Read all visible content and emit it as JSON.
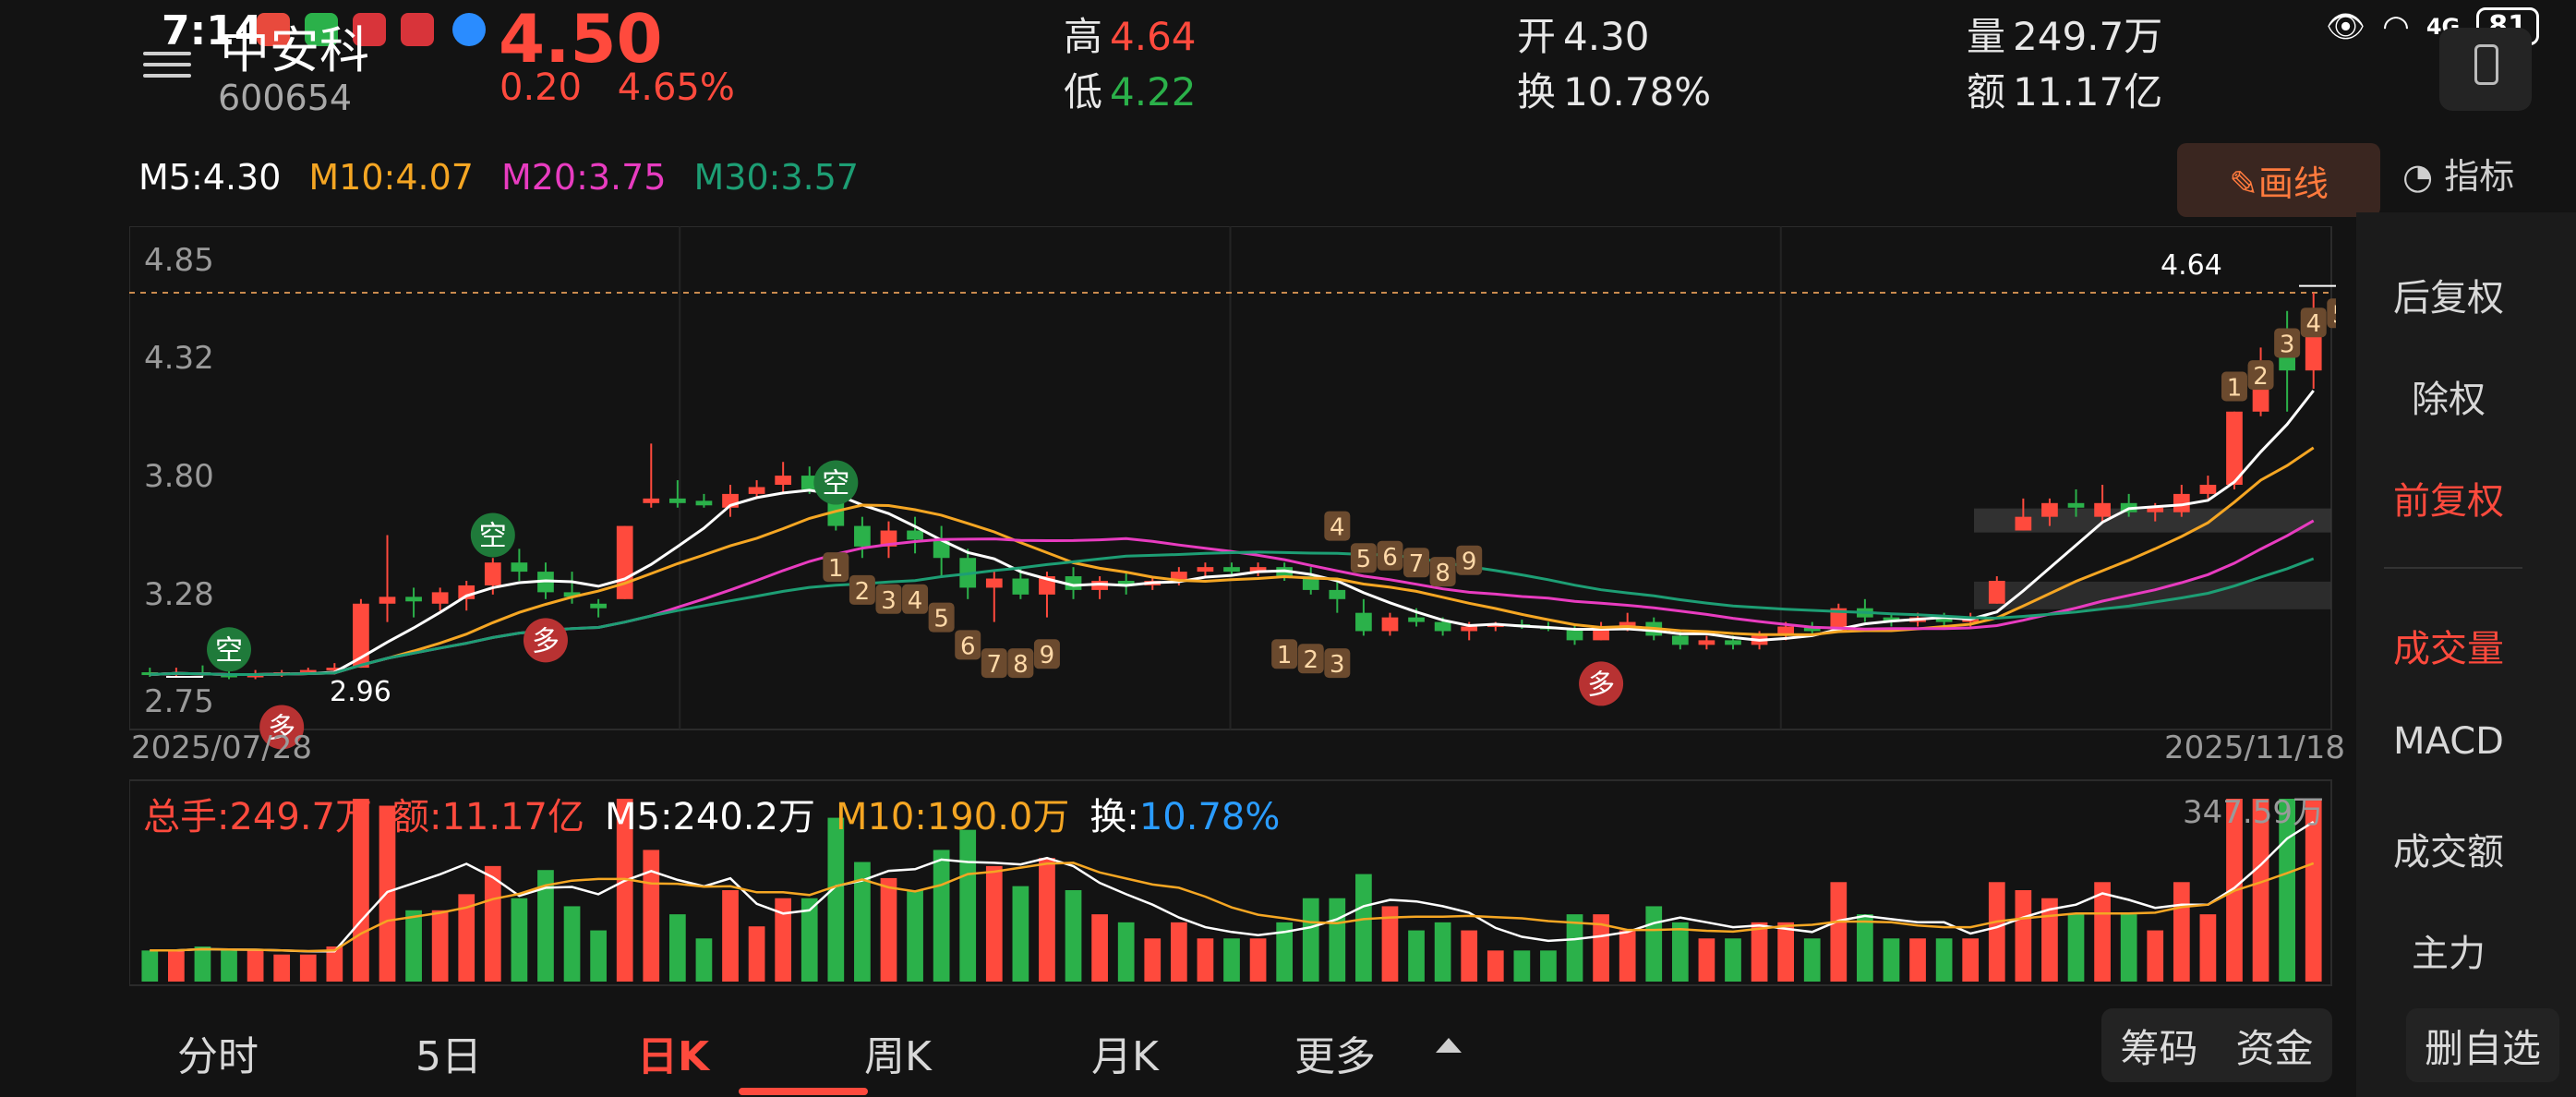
{
  "status": {
    "time": "7:14",
    "network": "4G",
    "battery": "81"
  },
  "stock": {
    "name": "中安科",
    "code": "600654",
    "price": "4.50",
    "change": "0.20",
    "change_pct": "4.65%",
    "high_label": "高",
    "high": "4.64",
    "low_label": "低",
    "low": "4.22",
    "open_label": "开",
    "open": "4.30",
    "turnover_label": "换",
    "turnover": "10.78%",
    "volume_label": "量",
    "volume": "249.7万",
    "amount_label": "额",
    "amount": "11.17亿"
  },
  "ma": {
    "m5": "M5:4.30",
    "m10": "M10:4.07",
    "m20": "M20:3.75",
    "m30": "M30:3.57"
  },
  "draw_button": "✎画线",
  "indicator_label": "指标",
  "side_options": [
    "后复权",
    "除权",
    "前复权"
  ],
  "side_active": "前复权",
  "side_indicators": [
    "成交量",
    "MACD",
    "成交额",
    "主力"
  ],
  "side_indicator_active": "成交量",
  "axis": {
    "y_ticks": [
      "4.85",
      "4.32",
      "3.80",
      "3.28",
      "2.75"
    ],
    "start_date": "2025/07/28",
    "end_date": "2025/11/18"
  },
  "annotations": {
    "max_label": "4.64",
    "min_label": "2.96",
    "bull": "多",
    "bear": "空"
  },
  "volume_panel": {
    "total": "总手:249.7万",
    "amount": "额:11.17亿",
    "m5": "M5:240.2万",
    "m10": "M10:190.0万",
    "turnover_label": "换:",
    "turnover": "10.78%",
    "max": "347.59万"
  },
  "tabs": [
    "分时",
    "5日",
    "日K",
    "周K",
    "月K",
    "更多"
  ],
  "active_tab": "日K",
  "bottom_buttons": {
    "chips": "筹码",
    "funds": "资金",
    "remove": "删自选"
  },
  "colors": {
    "up": "#ff4a3d",
    "down": "#2bb14a",
    "ma5": "#ffffff",
    "ma10": "#f5a623",
    "ma20": "#e83cc0",
    "ma30": "#1d9e74"
  },
  "chart_data": {
    "type": "candlestick",
    "y_range": [
      2.75,
      4.85
    ],
    "first_date": "2025/07/28",
    "last_date": "2025/11/18",
    "candles": [
      {
        "o": 2.98,
        "h": 3.0,
        "l": 2.96,
        "c": 2.97
      },
      {
        "o": 2.97,
        "h": 3.0,
        "l": 2.96,
        "c": 2.98
      },
      {
        "o": 2.98,
        "h": 3.01,
        "l": 2.96,
        "c": 2.97
      },
      {
        "o": 2.97,
        "h": 2.99,
        "l": 2.95,
        "c": 2.96
      },
      {
        "o": 2.96,
        "h": 2.99,
        "l": 2.95,
        "c": 2.97
      },
      {
        "o": 2.97,
        "h": 2.99,
        "l": 2.96,
        "c": 2.98
      },
      {
        "o": 2.98,
        "h": 3.0,
        "l": 2.97,
        "c": 2.99
      },
      {
        "o": 2.99,
        "h": 3.02,
        "l": 2.97,
        "c": 3.0
      },
      {
        "o": 3.0,
        "h": 3.3,
        "l": 3.0,
        "c": 3.28
      },
      {
        "o": 3.28,
        "h": 3.58,
        "l": 3.2,
        "c": 3.31
      },
      {
        "o": 3.31,
        "h": 3.35,
        "l": 3.22,
        "c": 3.29
      },
      {
        "o": 3.28,
        "h": 3.35,
        "l": 3.25,
        "c": 3.33
      },
      {
        "o": 3.3,
        "h": 3.38,
        "l": 3.25,
        "c": 3.36
      },
      {
        "o": 3.36,
        "h": 3.48,
        "l": 3.32,
        "c": 3.46
      },
      {
        "o": 3.46,
        "h": 3.52,
        "l": 3.38,
        "c": 3.42
      },
      {
        "o": 3.42,
        "h": 3.46,
        "l": 3.3,
        "c": 3.33
      },
      {
        "o": 3.33,
        "h": 3.42,
        "l": 3.28,
        "c": 3.31
      },
      {
        "o": 3.28,
        "h": 3.3,
        "l": 3.22,
        "c": 3.26
      },
      {
        "o": 3.3,
        "h": 3.62,
        "l": 3.3,
        "c": 3.62
      },
      {
        "o": 3.72,
        "h": 3.98,
        "l": 3.7,
        "c": 3.74
      },
      {
        "o": 3.74,
        "h": 3.82,
        "l": 3.7,
        "c": 3.72
      },
      {
        "o": 3.73,
        "h": 3.76,
        "l": 3.7,
        "c": 3.71
      },
      {
        "o": 3.7,
        "h": 3.8,
        "l": 3.66,
        "c": 3.76
      },
      {
        "o": 3.76,
        "h": 3.82,
        "l": 3.74,
        "c": 3.79
      },
      {
        "o": 3.8,
        "h": 3.9,
        "l": 3.76,
        "c": 3.84
      },
      {
        "o": 3.84,
        "h": 3.88,
        "l": 3.76,
        "c": 3.78
      },
      {
        "o": 3.78,
        "h": 3.82,
        "l": 3.6,
        "c": 3.62
      },
      {
        "o": 3.62,
        "h": 3.66,
        "l": 3.48,
        "c": 3.53
      },
      {
        "o": 3.53,
        "h": 3.64,
        "l": 3.48,
        "c": 3.6
      },
      {
        "o": 3.6,
        "h": 3.66,
        "l": 3.5,
        "c": 3.56
      },
      {
        "o": 3.56,
        "h": 3.62,
        "l": 3.4,
        "c": 3.48
      },
      {
        "o": 3.48,
        "h": 3.52,
        "l": 3.3,
        "c": 3.35
      },
      {
        "o": 3.35,
        "h": 3.42,
        "l": 3.2,
        "c": 3.39
      },
      {
        "o": 3.39,
        "h": 3.44,
        "l": 3.3,
        "c": 3.32
      },
      {
        "o": 3.32,
        "h": 3.42,
        "l": 3.22,
        "c": 3.4
      },
      {
        "o": 3.4,
        "h": 3.44,
        "l": 3.3,
        "c": 3.34
      },
      {
        "o": 3.34,
        "h": 3.4,
        "l": 3.3,
        "c": 3.38
      },
      {
        "o": 3.38,
        "h": 3.42,
        "l": 3.32,
        "c": 3.36
      },
      {
        "o": 3.36,
        "h": 3.4,
        "l": 3.34,
        "c": 3.38
      },
      {
        "o": 3.38,
        "h": 3.44,
        "l": 3.36,
        "c": 3.42
      },
      {
        "o": 3.42,
        "h": 3.46,
        "l": 3.4,
        "c": 3.44
      },
      {
        "o": 3.44,
        "h": 3.46,
        "l": 3.4,
        "c": 3.42
      },
      {
        "o": 3.42,
        "h": 3.46,
        "l": 3.4,
        "c": 3.44
      },
      {
        "o": 3.44,
        "h": 3.46,
        "l": 3.38,
        "c": 3.4
      },
      {
        "o": 3.4,
        "h": 3.44,
        "l": 3.32,
        "c": 3.34
      },
      {
        "o": 3.34,
        "h": 3.38,
        "l": 3.24,
        "c": 3.3
      },
      {
        "o": 3.24,
        "h": 3.3,
        "l": 3.14,
        "c": 3.16
      },
      {
        "o": 3.16,
        "h": 3.24,
        "l": 3.14,
        "c": 3.22
      },
      {
        "o": 3.22,
        "h": 3.26,
        "l": 3.18,
        "c": 3.2
      },
      {
        "o": 3.2,
        "h": 3.22,
        "l": 3.14,
        "c": 3.16
      },
      {
        "o": 3.16,
        "h": 3.2,
        "l": 3.12,
        "c": 3.18
      },
      {
        "o": 3.18,
        "h": 3.2,
        "l": 3.16,
        "c": 3.19
      },
      {
        "o": 3.19,
        "h": 3.21,
        "l": 3.17,
        "c": 3.18
      },
      {
        "o": 3.18,
        "h": 3.2,
        "l": 3.16,
        "c": 3.17
      },
      {
        "o": 3.17,
        "h": 3.19,
        "l": 3.1,
        "c": 3.12
      },
      {
        "o": 3.12,
        "h": 3.2,
        "l": 3.12,
        "c": 3.18
      },
      {
        "o": 3.18,
        "h": 3.24,
        "l": 3.16,
        "c": 3.2
      },
      {
        "o": 3.2,
        "h": 3.22,
        "l": 3.12,
        "c": 3.14
      },
      {
        "o": 3.14,
        "h": 3.16,
        "l": 3.08,
        "c": 3.1
      },
      {
        "o": 3.1,
        "h": 3.14,
        "l": 3.08,
        "c": 3.12
      },
      {
        "o": 3.12,
        "h": 3.14,
        "l": 3.08,
        "c": 3.1
      },
      {
        "o": 3.1,
        "h": 3.16,
        "l": 3.08,
        "c": 3.14
      },
      {
        "o": 3.14,
        "h": 3.2,
        "l": 3.12,
        "c": 3.18
      },
      {
        "o": 3.18,
        "h": 3.2,
        "l": 3.14,
        "c": 3.16
      },
      {
        "o": 3.16,
        "h": 3.28,
        "l": 3.16,
        "c": 3.26
      },
      {
        "o": 3.26,
        "h": 3.3,
        "l": 3.2,
        "c": 3.22
      },
      {
        "o": 3.22,
        "h": 3.24,
        "l": 3.18,
        "c": 3.2
      },
      {
        "o": 3.2,
        "h": 3.24,
        "l": 3.18,
        "c": 3.22
      },
      {
        "o": 3.22,
        "h": 3.24,
        "l": 3.18,
        "c": 3.2
      },
      {
        "o": 3.2,
        "h": 3.24,
        "l": 3.18,
        "c": 3.22
      },
      {
        "o": 3.28,
        "h": 3.4,
        "l": 3.28,
        "c": 3.38
      },
      {
        "o": 3.6,
        "h": 3.74,
        "l": 3.6,
        "c": 3.66
      },
      {
        "o": 3.66,
        "h": 3.74,
        "l": 3.62,
        "c": 3.72
      },
      {
        "o": 3.72,
        "h": 3.78,
        "l": 3.66,
        "c": 3.7
      },
      {
        "o": 3.66,
        "h": 3.8,
        "l": 3.64,
        "c": 3.72
      },
      {
        "o": 3.72,
        "h": 3.76,
        "l": 3.66,
        "c": 3.68
      },
      {
        "o": 3.68,
        "h": 3.72,
        "l": 3.64,
        "c": 3.7
      },
      {
        "o": 3.68,
        "h": 3.8,
        "l": 3.66,
        "c": 3.76
      },
      {
        "o": 3.76,
        "h": 3.84,
        "l": 3.74,
        "c": 3.8
      },
      {
        "o": 3.8,
        "h": 4.12,
        "l": 3.78,
        "c": 4.12
      },
      {
        "o": 4.12,
        "h": 4.4,
        "l": 4.1,
        "c": 4.34
      },
      {
        "o": 4.4,
        "h": 4.56,
        "l": 4.12,
        "c": 4.3
      },
      {
        "o": 4.3,
        "h": 4.64,
        "l": 4.22,
        "c": 4.5
      }
    ],
    "volume_max": 347.59
  }
}
